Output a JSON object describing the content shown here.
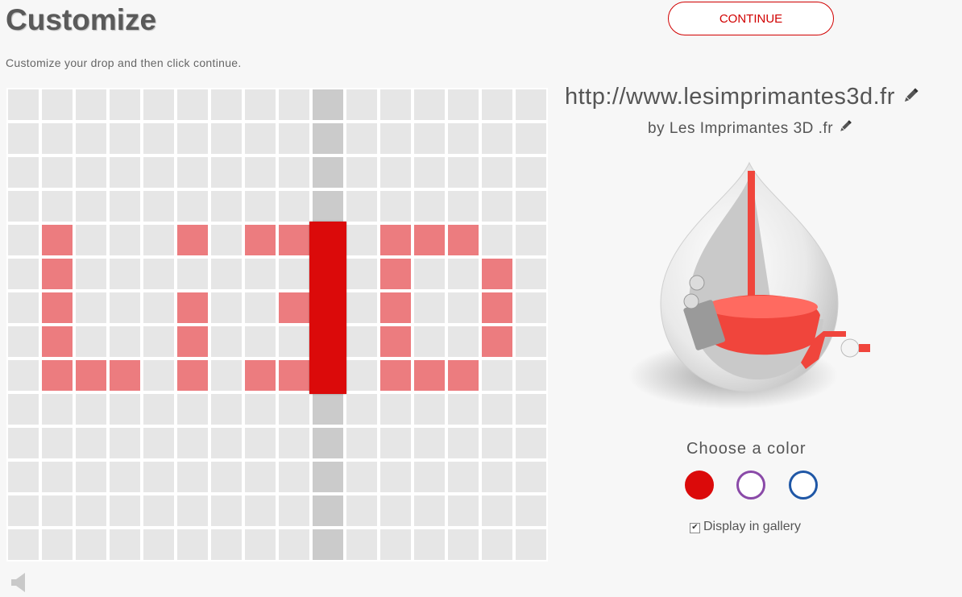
{
  "header": {
    "title": "Customize",
    "subtitle": "Customize your drop and then click continue.",
    "continue_label": "CONTINUE"
  },
  "grid": {
    "rows": 14,
    "cols": 16,
    "active_column": 9,
    "on_cells": [
      [
        4,
        1
      ],
      [
        4,
        5
      ],
      [
        4,
        7
      ],
      [
        4,
        8
      ],
      [
        4,
        9
      ],
      [
        4,
        11
      ],
      [
        4,
        12
      ],
      [
        4,
        13
      ],
      [
        5,
        1
      ],
      [
        5,
        9
      ],
      [
        5,
        11
      ],
      [
        5,
        14
      ],
      [
        6,
        1
      ],
      [
        6,
        5
      ],
      [
        6,
        8
      ],
      [
        6,
        9
      ],
      [
        6,
        11
      ],
      [
        6,
        14
      ],
      [
        7,
        1
      ],
      [
        7,
        5
      ],
      [
        7,
        9
      ],
      [
        7,
        11
      ],
      [
        7,
        14
      ],
      [
        8,
        1
      ],
      [
        8,
        2
      ],
      [
        8,
        3
      ],
      [
        8,
        5
      ],
      [
        8,
        7
      ],
      [
        8,
        8
      ],
      [
        8,
        9
      ],
      [
        8,
        11
      ],
      [
        8,
        12
      ],
      [
        8,
        13
      ]
    ]
  },
  "drop": {
    "url": "http://www.lesimprimantes3d.fr",
    "author": "by Les Imprimantes 3D .fr"
  },
  "colors": {
    "label": "Choose a color",
    "options": [
      {
        "name": "red",
        "hex": "#db0a0a",
        "selected": true
      },
      {
        "name": "purple",
        "hex": "#8a4aa8",
        "selected": false
      },
      {
        "name": "blue",
        "hex": "#1f57a6",
        "selected": false
      }
    ]
  },
  "gallery": {
    "label": "Display in gallery",
    "checked": true
  },
  "icons": {
    "edit": "pencil-icon",
    "sound": "speaker-icon"
  }
}
